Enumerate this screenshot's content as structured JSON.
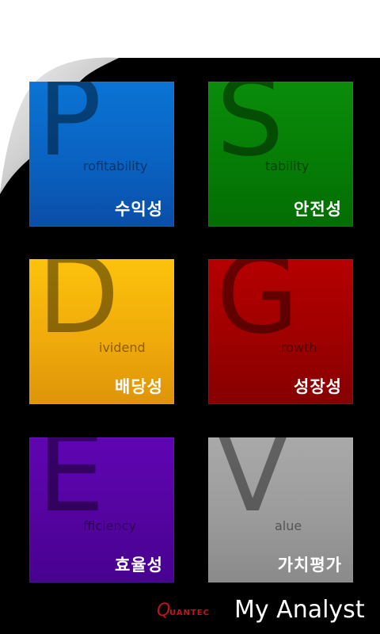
{
  "tiles": [
    {
      "id": "p",
      "letter": "P",
      "word": "rofitability",
      "label": "수익성"
    },
    {
      "id": "s",
      "letter": "S",
      "word": "tability",
      "label": "안전성"
    },
    {
      "id": "d",
      "letter": "D",
      "word": "ividend",
      "label": "배당성"
    },
    {
      "id": "g",
      "letter": "G",
      "word": "rowth",
      "label": "성장성"
    },
    {
      "id": "e",
      "letter": "E",
      "word": "fficiency",
      "label": "효율성"
    },
    {
      "id": "v",
      "letter": "V",
      "word": "alue",
      "label": "가치평가"
    }
  ],
  "brand": {
    "logo_first": "Q",
    "logo_rest": "UANTEC",
    "app_title": "My Analyst"
  },
  "colors": {
    "profitability": "#0a64c4",
    "stability": "#068006",
    "dividend": "#f2ae0b",
    "growth": "#a00000",
    "efficiency": "#5603a3",
    "value": "#9b9b9b",
    "logo": "#c0161b"
  }
}
